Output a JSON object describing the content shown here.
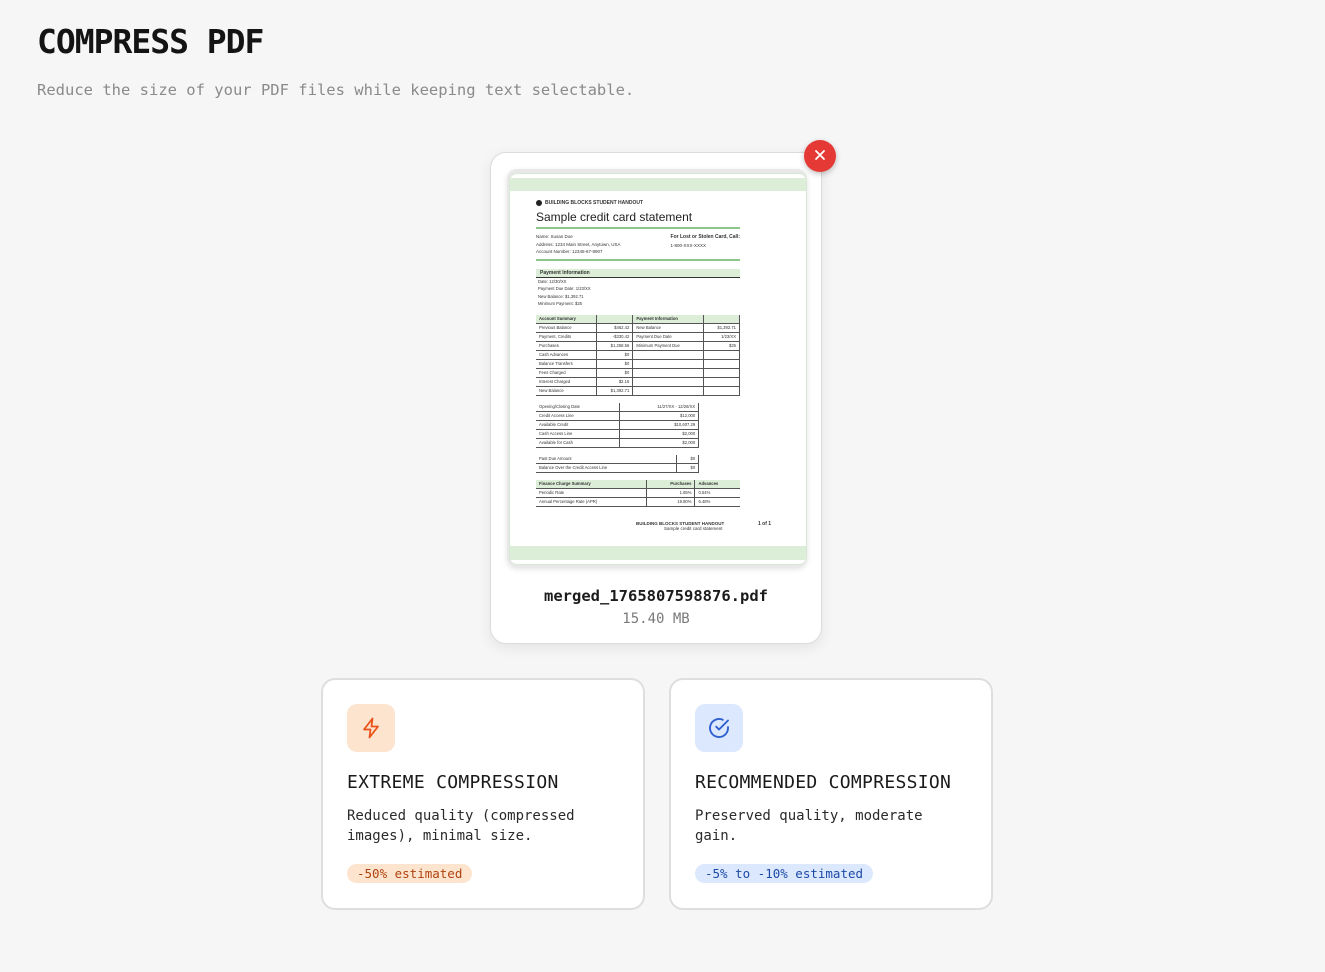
{
  "page": {
    "title": "COMPRESS PDF",
    "subtitle": "Reduce the size of your PDF files while keeping text selectable."
  },
  "file": {
    "name": "merged_1765807598876.pdf",
    "size": "15.40 MB",
    "remove_icon": "close-icon",
    "preview": {
      "header": "BUILDING BLOCKS STUDENT HANDOUT",
      "title": "Sample credit card statement",
      "name_line": "Name: Susan Doe",
      "address_line": "Address: 1234 Main Street, Anytown, USA",
      "account_line": "Account Number: 12345-67-8907",
      "lost_card": "For Lost or Stolen Card, Call:",
      "lost_phone": "1-800-XXX-XXXX",
      "payment_info_head": "Payment Information",
      "payment_lines": [
        "Date: 12/30/XX",
        "Payment Due Date: 1/23/XX",
        "New Balance: $1,392.71",
        "Minimum Payment: $25"
      ],
      "summary_head": [
        "Account Summary",
        "",
        "Payment Information",
        ""
      ],
      "summary_rows": [
        [
          "Previous Balance",
          "$462.42",
          "New Balance",
          "$1,392.71"
        ],
        [
          "Payment, Credits",
          "-$330.42",
          "Payment Due Date",
          "1/23/XX"
        ],
        [
          "Purchases",
          "$1,258.56",
          "Minimum Payment Due",
          "$25"
        ],
        [
          "Cash Advances",
          "$0",
          "",
          ""
        ],
        [
          "Balance Transfers",
          "$0",
          "",
          ""
        ],
        [
          "Fees Charged",
          "$0",
          "",
          ""
        ],
        [
          "Interest Charged",
          "$2.15",
          "",
          ""
        ],
        [
          "New Balance",
          "$1,392.71",
          "",
          ""
        ]
      ],
      "credit_rows": [
        [
          "Opening/Closing Date",
          "11/27/XX - 12/26/XX"
        ],
        [
          "Credit Access Line",
          "$12,000"
        ],
        [
          "Available Credit",
          "$10,607.29"
        ],
        [
          "Cash Access Line",
          "$2,000"
        ],
        [
          "Available for Cash",
          "$2,000"
        ]
      ],
      "past_rows": [
        [
          "Past Due Amount",
          "$0"
        ],
        [
          "Balance Over the Credit Access Line",
          "$0"
        ]
      ],
      "finance_head": [
        "Finance Charge Summary",
        "Purchases",
        "Advances"
      ],
      "finance_rows": [
        [
          "Periodic Rate",
          "1.65%",
          "0.54%"
        ],
        [
          "Annual Percentage Rate (APR)",
          "19.80%",
          "6.48%"
        ]
      ],
      "footer_a": "BUILDING BLOCKS STUDENT HANDOUT",
      "footer_b": "Sample credit card statement",
      "footer_page": "1 of 1"
    }
  },
  "options": [
    {
      "id": "extreme",
      "icon": "lightning-icon",
      "title": "EXTREME COMPRESSION",
      "description": "Reduced quality (compressed images), minimal size.",
      "badge": "-50% estimated",
      "accent": "#e8541c"
    },
    {
      "id": "recommended",
      "icon": "check-circle-icon",
      "title": "RECOMMENDED COMPRESSION",
      "description": "Preserved quality, moderate gain.",
      "badge": "-5% to -10% estimated",
      "accent": "#2f5fd0"
    }
  ],
  "colors": {
    "background": "#f6f6f6",
    "remove_button": "#e53935"
  }
}
